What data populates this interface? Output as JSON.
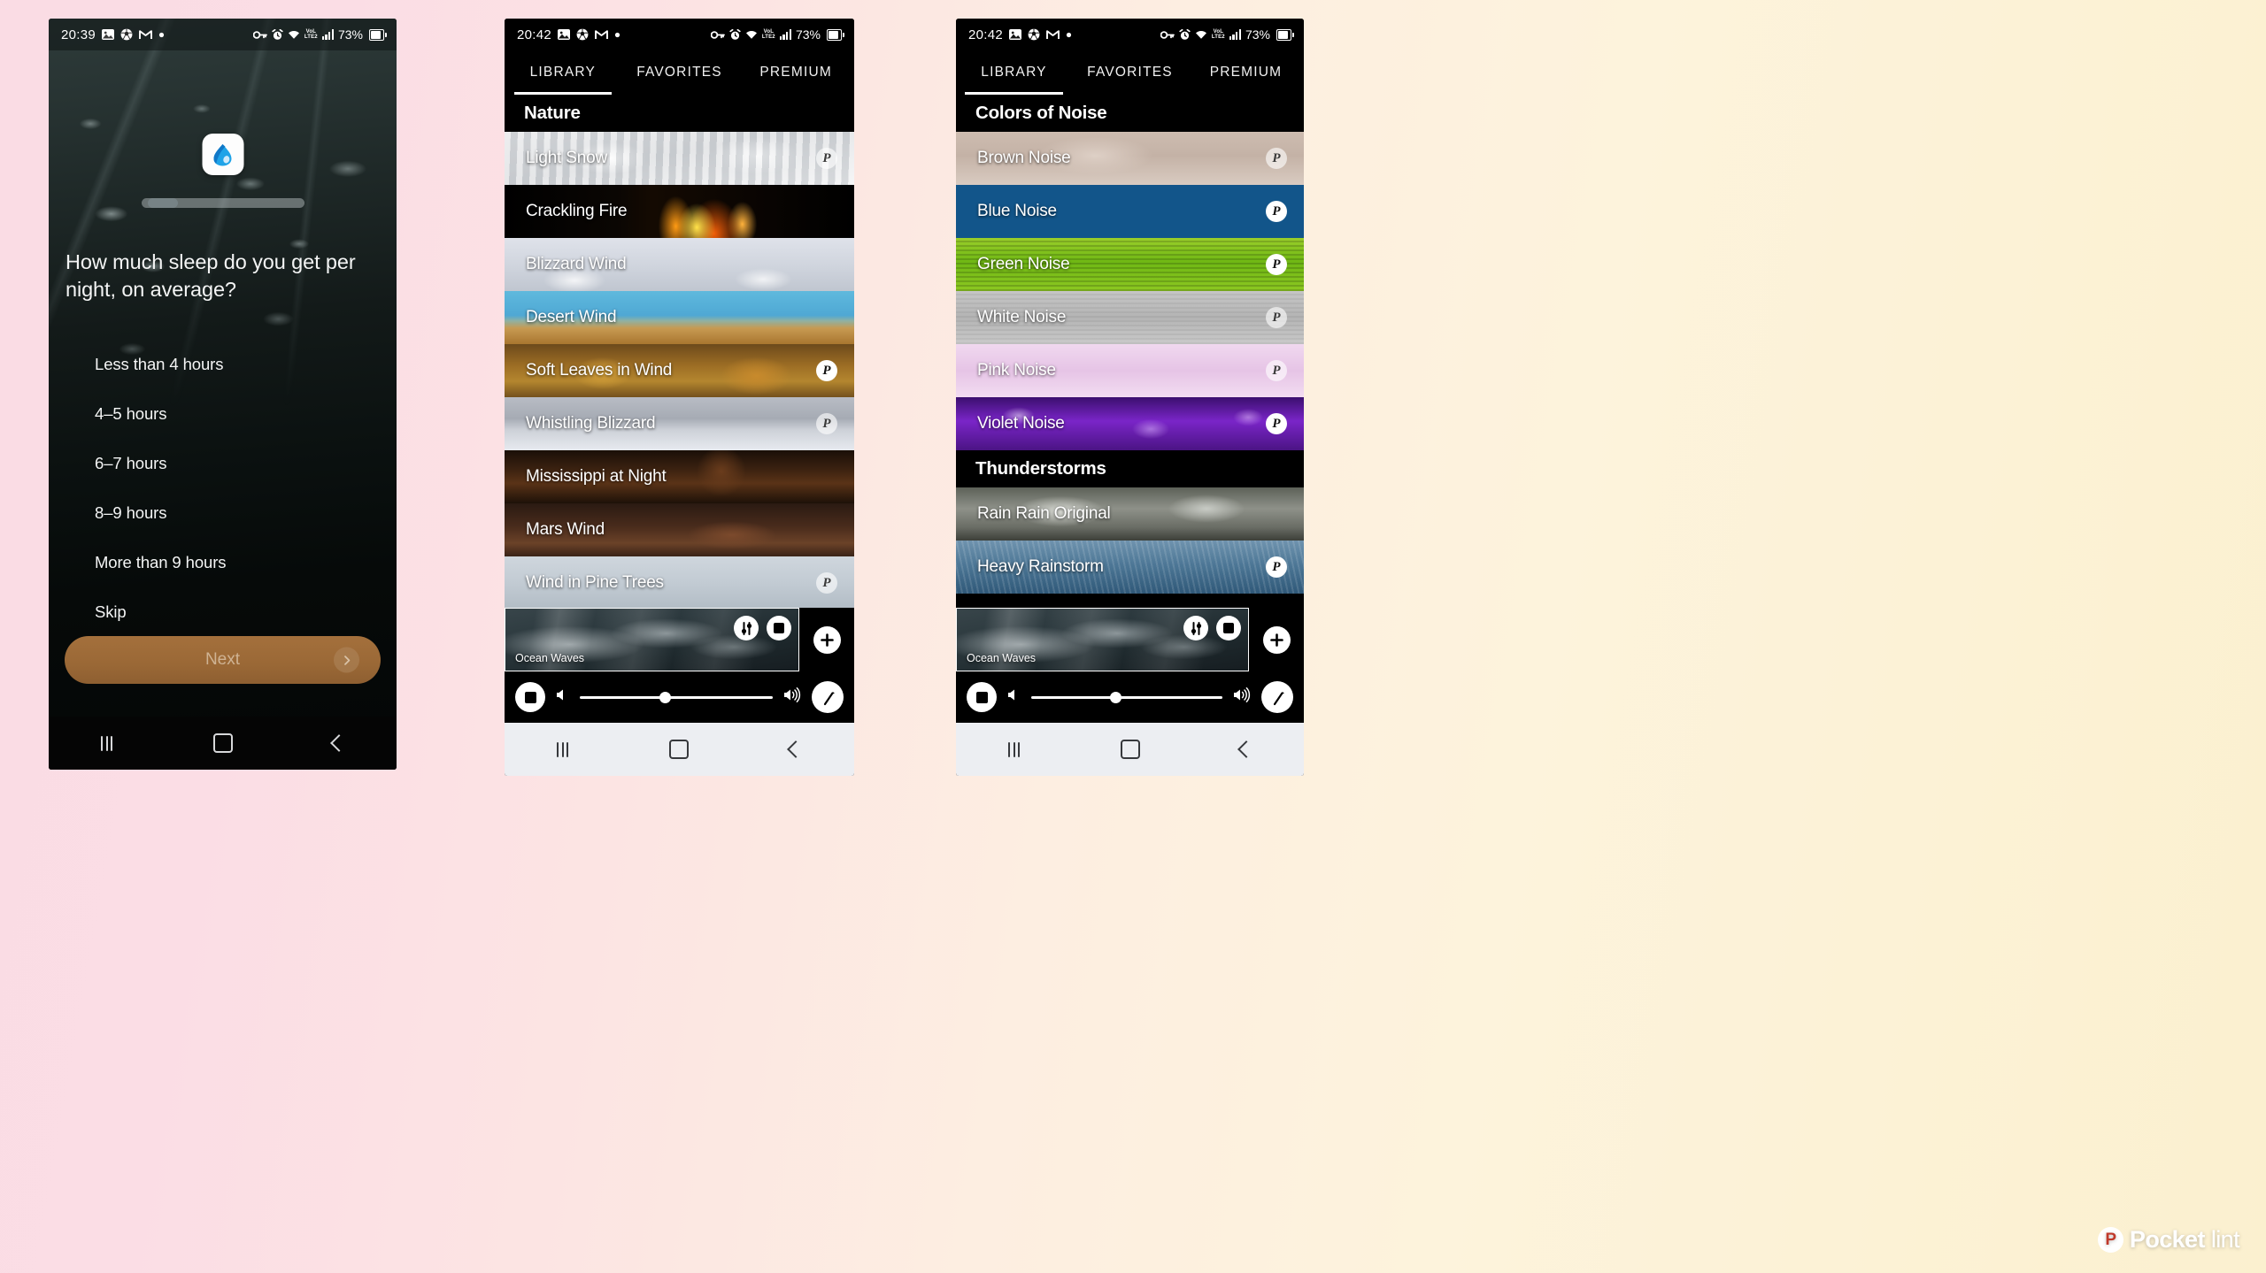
{
  "watermark": {
    "mark": "P",
    "text1": "Pocket",
    "text2": "lint"
  },
  "phone1": {
    "status": {
      "time": "20:39",
      "icons": [
        "photos-icon",
        "sports-icon",
        "gmail-icon",
        "dot-icon",
        "key-icon",
        "alarm-icon",
        "wifi-icon",
        "volte-icon",
        "signal-icon"
      ],
      "battery": "73%"
    },
    "app_icon": "water-drop-icon",
    "question": "How much sleep do you get per night, on average?",
    "options": [
      "Less than 4 hours",
      "4–5 hours",
      "6–7 hours",
      "8–9 hours",
      "More than 9 hours",
      "Skip"
    ],
    "next_label": "Next",
    "nav": [
      "recents-icon",
      "home-icon",
      "back-icon"
    ]
  },
  "phone2": {
    "status": {
      "time": "20:42",
      "battery": "73%"
    },
    "tabs": [
      {
        "label": "LIBRARY",
        "active": true
      },
      {
        "label": "FAVORITES",
        "active": false
      },
      {
        "label": "PREMIUM",
        "active": false
      }
    ],
    "section": "Nature",
    "items": [
      {
        "title": "Light Snow",
        "premium": true,
        "ghost": true
      },
      {
        "title": "Crackling Fire",
        "premium": false,
        "ghost": false
      },
      {
        "title": "Blizzard Wind",
        "premium": false,
        "ghost": false
      },
      {
        "title": "Desert Wind",
        "premium": false,
        "ghost": false
      },
      {
        "title": "Soft Leaves in Wind",
        "premium": true,
        "ghost": false
      },
      {
        "title": "Whistling Blizzard",
        "premium": true,
        "ghost": true
      },
      {
        "title": "Mississippi at Night",
        "premium": false,
        "ghost": false
      },
      {
        "title": "Mars Wind",
        "premium": false,
        "ghost": false
      },
      {
        "title": "Wind in Pine Trees",
        "premium": true,
        "ghost": true
      }
    ],
    "player": {
      "now_playing": "Ocean Waves",
      "mix_icon": "mixer-icon",
      "stop_small_icon": "stop-icon",
      "add_icon": "plus-icon",
      "stop_icon": "stop-icon",
      "vol_min_icon": "volume-low-icon",
      "vol_max_icon": "volume-high-icon",
      "timer_icon": "sleep-timer-icon",
      "volume_percent": 44
    },
    "nav": [
      "recents-icon",
      "home-icon",
      "back-icon"
    ]
  },
  "phone3": {
    "status": {
      "time": "20:42",
      "battery": "73%"
    },
    "tabs": [
      {
        "label": "LIBRARY",
        "active": true
      },
      {
        "label": "FAVORITES",
        "active": false
      },
      {
        "label": "PREMIUM",
        "active": false
      }
    ],
    "section1": "Colors of Noise",
    "items1": [
      {
        "title": "Brown Noise",
        "premium": true,
        "ghost": true
      },
      {
        "title": "Blue Noise",
        "premium": true,
        "ghost": false
      },
      {
        "title": "Green Noise",
        "premium": true,
        "ghost": false
      },
      {
        "title": "White Noise",
        "premium": true,
        "ghost": true
      },
      {
        "title": "Pink Noise",
        "premium": true,
        "ghost": true
      },
      {
        "title": "Violet Noise",
        "premium": true,
        "ghost": false
      }
    ],
    "section2": "Thunderstorms",
    "items2": [
      {
        "title": "Rain Rain Original",
        "premium": false,
        "ghost": false
      },
      {
        "title": "Heavy Rainstorm",
        "premium": true,
        "ghost": false
      }
    ],
    "player": {
      "now_playing": "Ocean Waves",
      "volume_percent": 44
    },
    "nav": [
      "recents-icon",
      "home-icon",
      "back-icon"
    ]
  }
}
